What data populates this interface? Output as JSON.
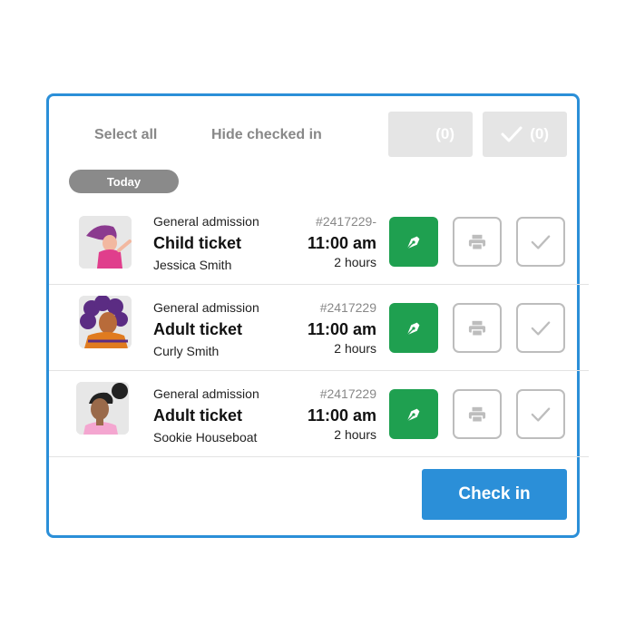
{
  "toolbar": {
    "select_all": "Select all",
    "hide_checked_in": "Hide checked in",
    "pending_count": "(0)",
    "checked_count": "(0)"
  },
  "section": {
    "label": "Today"
  },
  "tickets": [
    {
      "kind": "General admission",
      "ticket": "Child ticket",
      "holder": "Jessica Smith",
      "order": "#2417229-",
      "time": "11:00 am",
      "duration": "2 hours",
      "avatar": "avatar-pink-hair-icon"
    },
    {
      "kind": "General admission",
      "ticket": "Adult ticket",
      "holder": "Curly Smith",
      "order": "#2417229",
      "time": "11:00 am",
      "duration": "2 hours",
      "avatar": "avatar-purple-curly-icon"
    },
    {
      "kind": "General admission",
      "ticket": "Adult ticket",
      "holder": "Sookie Houseboat",
      "order": "#2417229",
      "time": "11:00 am",
      "duration": "2 hours",
      "avatar": "avatar-bun-hair-icon"
    }
  ],
  "actions": {
    "check_in": "Check in"
  },
  "colors": {
    "accent": "#2b8fd8",
    "sign_green": "#1fa050",
    "pill_grey": "#8a8a8a"
  }
}
